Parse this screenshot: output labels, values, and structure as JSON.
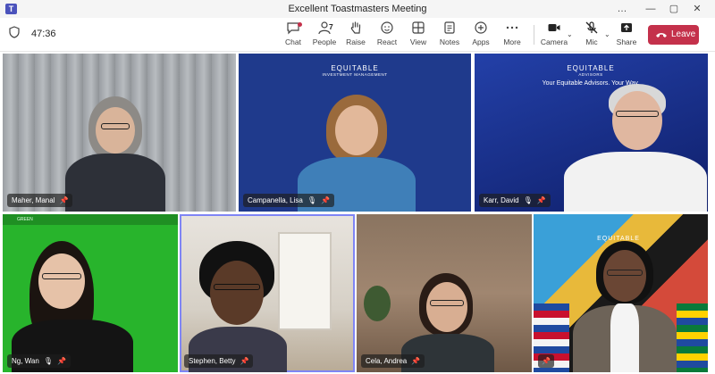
{
  "window": {
    "title": "Excellent Toastmasters Meeting",
    "app_icon": "teams-icon",
    "controls": [
      "…",
      "—",
      "▢",
      "✕"
    ]
  },
  "toolbar": {
    "timer": "47:36",
    "buttons": [
      {
        "label": "Chat",
        "icon": "chat-icon"
      },
      {
        "label": "People",
        "icon": "people-icon",
        "count": "7"
      },
      {
        "label": "Raise",
        "icon": "raise-hand-icon"
      },
      {
        "label": "React",
        "icon": "react-icon"
      },
      {
        "label": "View",
        "icon": "view-icon"
      },
      {
        "label": "Notes",
        "icon": "notes-icon"
      },
      {
        "label": "Apps",
        "icon": "apps-icon"
      },
      {
        "label": "More",
        "icon": "more-icon"
      },
      {
        "label": "Camera",
        "icon": "camera-icon"
      },
      {
        "label": "Mic",
        "icon": "mic-muted-icon"
      },
      {
        "label": "Share",
        "icon": "share-icon"
      }
    ],
    "leave_label": "Leave",
    "leave_color": "#c4314b"
  },
  "participants": [
    {
      "name": "Maher, Manal",
      "muted": false,
      "pinned": true
    },
    {
      "name": "Campanella, Lisa",
      "muted": true,
      "pinned": true
    },
    {
      "name": "Karr, David",
      "muted": true,
      "pinned": true
    },
    {
      "name": "Ng, Wan",
      "muted": true,
      "pinned": true
    },
    {
      "name": "Stephen, Betty",
      "muted": false,
      "pinned": true,
      "active_speaker": true
    },
    {
      "name": "Cela, Andrea",
      "muted": false,
      "pinned": true
    },
    {
      "name": "",
      "muted": false,
      "pinned": true
    }
  ],
  "backgrounds": {
    "equitable_im": {
      "brand": "EQUITABLE",
      "sub": "INVESTMENT MANAGEMENT"
    },
    "equitable_adv": {
      "brand": "EQUITABLE",
      "sub": "ADVISORS",
      "tagline": "Your Equitable Advisors. Your Way."
    },
    "green_label": "GREEN",
    "flags_brand": "EQUITABLE"
  }
}
